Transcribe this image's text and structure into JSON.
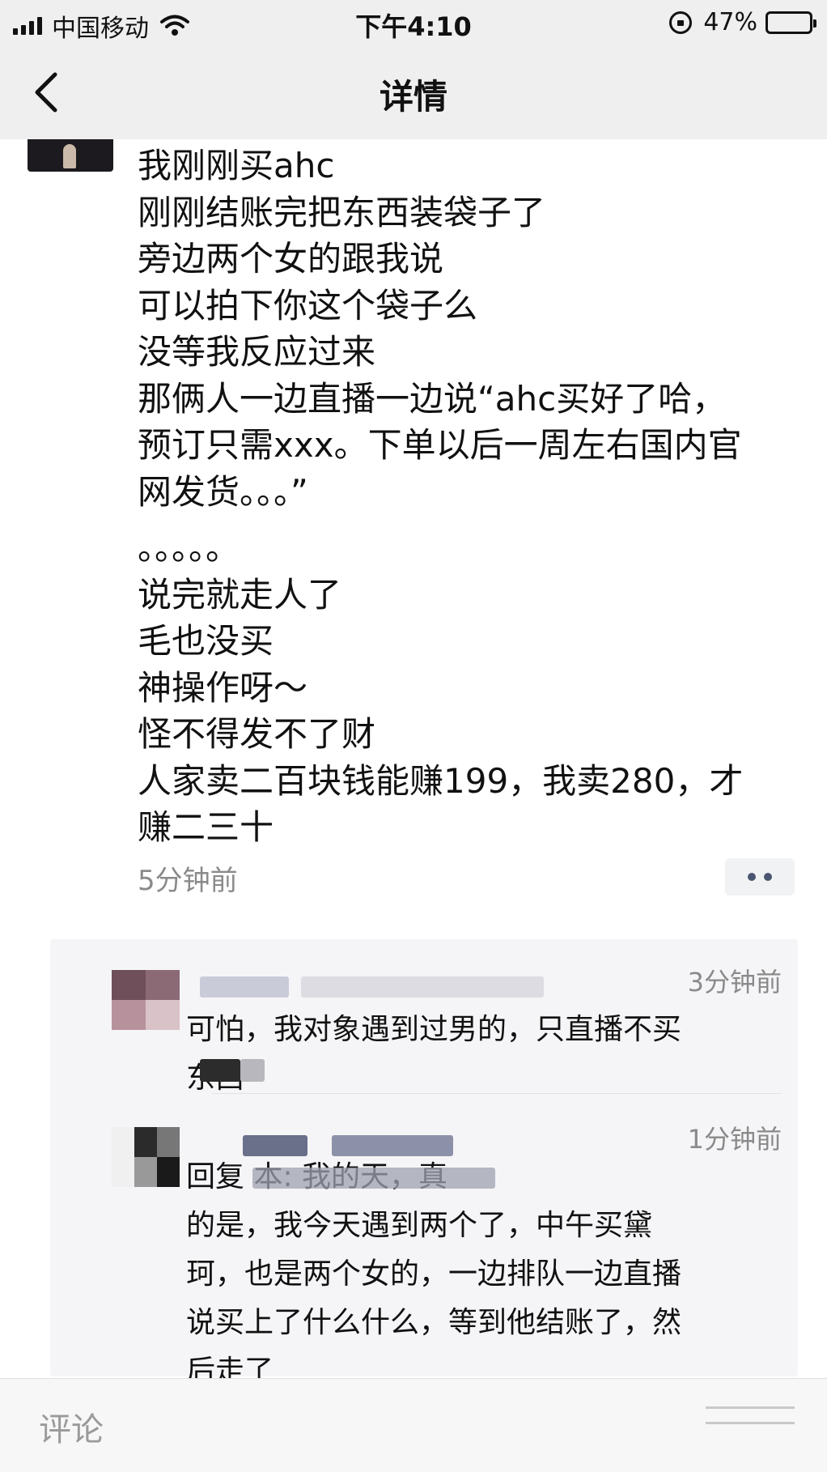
{
  "status_bar": {
    "carrier": "中国移动",
    "time": "下午4:10",
    "battery_percent": "47%",
    "battery_level": 0.47,
    "icons": [
      "signal-icon",
      "wifi-icon",
      "rotation-lock-icon",
      "battery-icon"
    ]
  },
  "nav": {
    "title": "详情",
    "back_icon": "chevron-left-icon"
  },
  "post": {
    "lines": [
      "我刚刚买ahc",
      "刚刚结账完把东西装袋子了",
      "旁边两个女的跟我说",
      "可以拍下你这个袋子么",
      "没等我反应过来",
      "那俩人一边直播一边说“ahc买好了哈，",
      "预订只需xxx。下单以后一周左右国内官",
      "网发货。。。”",
      "",
      "。。。。。",
      "说完就走人了",
      "毛也没买",
      "神操作呀～",
      "怪不得发不了财",
      "人家卖二百块钱能赚199，我卖280，才",
      "赚二三十"
    ],
    "time": "5分钟前",
    "more_icon": "more-dots-icon"
  },
  "comments": [
    {
      "time": "3分钟前",
      "lines": [
        "可怕，我对象遇到过男的，只直播不买",
        "东西"
      ]
    },
    {
      "time": "1分钟前",
      "lines": [
        "回复                 本: 我的天，真",
        "的是，我今天遇到两个了，中午买黛",
        "珂，也是两个女的，一边排队一边直播",
        "说买上了什么什么，等到他结账了，然",
        "后走了"
      ]
    }
  ],
  "bottom_bar": {
    "comment_placeholder": "评论",
    "emoji_icon": "emoji-icon"
  },
  "colors": {
    "header_bg": "#efefef",
    "comment_bg": "#f5f5f7",
    "timestamp_gray": "#8a8a8a",
    "more_dots": "#4a5670"
  }
}
